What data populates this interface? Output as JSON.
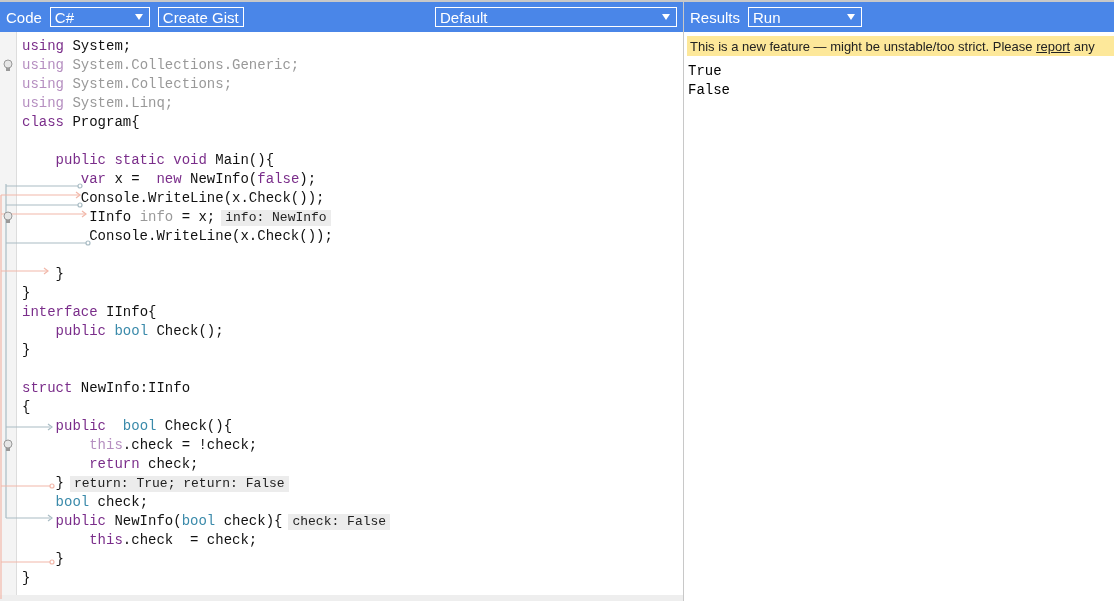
{
  "toolbar": {
    "code_label": "Code",
    "language": "C#",
    "gist_button": "Create Gist",
    "mode": "Default",
    "results_label": "Results",
    "run_select": "Run"
  },
  "code": {
    "lines": [
      {
        "hint": false,
        "tokens": [
          {
            "kind": "kw",
            "text": "using"
          },
          {
            "kind": "plain",
            "text": " System;"
          }
        ]
      },
      {
        "hint": true,
        "tokens": [
          {
            "kind": "fadedkw",
            "text": "using"
          },
          {
            "kind": "faded",
            "text": " System.Collections.Generic;"
          }
        ]
      },
      {
        "hint": false,
        "tokens": [
          {
            "kind": "fadedkw",
            "text": "using"
          },
          {
            "kind": "faded",
            "text": " System.Collections;"
          }
        ]
      },
      {
        "hint": false,
        "tokens": [
          {
            "kind": "fadedkw",
            "text": "using"
          },
          {
            "kind": "faded",
            "text": " System.Linq;"
          }
        ]
      },
      {
        "hint": false,
        "tokens": [
          {
            "kind": "kw",
            "text": "class"
          },
          {
            "kind": "plain",
            "text": " Program{"
          }
        ]
      },
      {
        "hint": false
      },
      {
        "hint": false,
        "tokens": [
          {
            "kind": "kw",
            "text": "    public static void"
          },
          {
            "kind": "plain",
            "text": " Main(){"
          }
        ]
      },
      {
        "hint": false,
        "tokens": [
          {
            "kind": "kw",
            "text": "       var"
          },
          {
            "kind": "plain",
            "text": " x =  "
          },
          {
            "kind": "kw",
            "text": "new"
          },
          {
            "kind": "plain",
            "text": " NewInfo("
          },
          {
            "kind": "kw",
            "text": "false"
          },
          {
            "kind": "plain",
            "text": ");"
          }
        ]
      },
      {
        "hint": false,
        "tokens": [
          {
            "kind": "plain",
            "text": "       Console.WriteLine(x.Check());"
          }
        ]
      },
      {
        "hint": true,
        "note": "info: NewInfo",
        "tokens": [
          {
            "kind": "plain",
            "text": "        IInfo "
          },
          {
            "kind": "faded",
            "text": "info"
          },
          {
            "kind": "plain",
            "text": " = x;"
          }
        ]
      },
      {
        "hint": false,
        "tokens": [
          {
            "kind": "plain",
            "text": "        Console.WriteLine(x.Check());"
          }
        ]
      },
      {
        "hint": false
      },
      {
        "hint": false,
        "tokens": [
          {
            "kind": "plain",
            "text": "    }"
          }
        ]
      },
      {
        "hint": false,
        "tokens": [
          {
            "kind": "plain",
            "text": "}"
          }
        ]
      },
      {
        "hint": false,
        "tokens": [
          {
            "kind": "kw",
            "text": "interface"
          },
          {
            "kind": "plain",
            "text": " IInfo{"
          }
        ]
      },
      {
        "hint": false,
        "tokens": [
          {
            "kind": "kw",
            "text": "    public "
          },
          {
            "kind": "type",
            "text": "bool"
          },
          {
            "kind": "plain",
            "text": " Check();"
          }
        ]
      },
      {
        "hint": false,
        "tokens": [
          {
            "kind": "plain",
            "text": "}"
          }
        ]
      },
      {
        "hint": false
      },
      {
        "hint": false,
        "tokens": [
          {
            "kind": "kw",
            "text": "struct"
          },
          {
            "kind": "plain",
            "text": " NewInfo:IInfo"
          }
        ]
      },
      {
        "hint": false,
        "tokens": [
          {
            "kind": "plain",
            "text": "{"
          }
        ]
      },
      {
        "hint": false,
        "tokens": [
          {
            "kind": "kw",
            "text": "    public  "
          },
          {
            "kind": "type",
            "text": "bool"
          },
          {
            "kind": "plain",
            "text": " Check(){"
          }
        ]
      },
      {
        "hint": true,
        "tokens": [
          {
            "kind": "fadedkw",
            "text": "        this"
          },
          {
            "kind": "plain",
            "text": ".check = !check;"
          }
        ]
      },
      {
        "hint": false,
        "tokens": [
          {
            "kind": "kw",
            "text": "        return"
          },
          {
            "kind": "plain",
            "text": " check;"
          }
        ]
      },
      {
        "hint": false,
        "note": "return: True; return: False",
        "tokens": [
          {
            "kind": "plain",
            "text": "    }"
          }
        ]
      },
      {
        "hint": false,
        "tokens": [
          {
            "kind": "type",
            "text": "    bool"
          },
          {
            "kind": "plain",
            "text": " check;"
          }
        ]
      },
      {
        "hint": false,
        "note": "check: False",
        "tokens": [
          {
            "kind": "kw",
            "text": "    public"
          },
          {
            "kind": "plain",
            "text": " NewInfo("
          },
          {
            "kind": "type",
            "text": "bool"
          },
          {
            "kind": "plain",
            "text": " check){"
          }
        ]
      },
      {
        "hint": false,
        "tokens": [
          {
            "kind": "kw",
            "text": "        this"
          },
          {
            "kind": "plain",
            "text": ".check  = check;"
          }
        ]
      },
      {
        "hint": false,
        "tokens": [
          {
            "kind": "plain",
            "text": "    }"
          }
        ]
      },
      {
        "hint": false,
        "tokens": [
          {
            "kind": "plain",
            "text": "}"
          }
        ]
      }
    ]
  },
  "results": {
    "notice": {
      "before": "This is a new feature — might be unstable/too strict. Please ",
      "link": "report",
      "after": " any"
    },
    "output": [
      "True",
      "False"
    ]
  }
}
